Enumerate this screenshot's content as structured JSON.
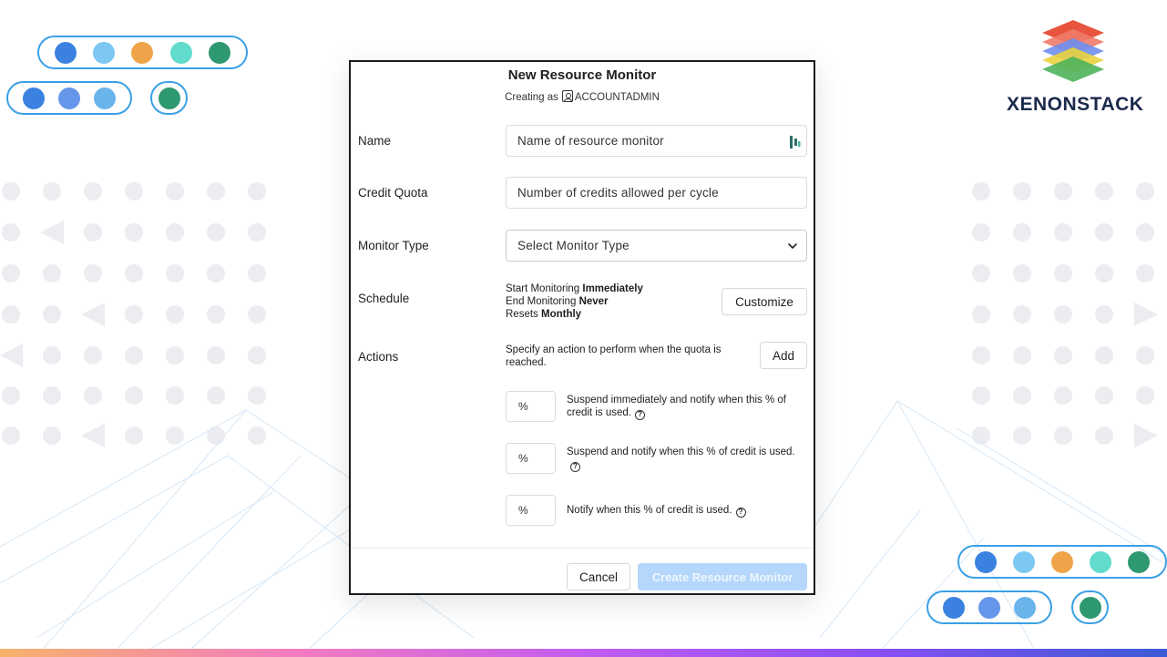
{
  "modal": {
    "title": "New Resource Monitor",
    "creating_as_prefix": "Creating as",
    "role": "ACCOUNTADMIN"
  },
  "form": {
    "name_label": "Name",
    "name_placeholder": "Name of resource monitor",
    "credit_label": "Credit Quota",
    "credit_placeholder": "Number of credits allowed per cycle",
    "monitor_type_label": "Monitor Type",
    "monitor_type_value": "Select Monitor Type",
    "schedule_label": "Schedule",
    "schedule": {
      "start_prefix": "Start Monitoring",
      "start_value": "Immediately",
      "end_prefix": "End Monitoring",
      "end_value": "Never",
      "reset_prefix": "Resets",
      "reset_value": "Monthly"
    },
    "customize_label": "Customize",
    "actions_label": "Actions",
    "actions_desc": "Specify an action to perform when the quota is reached.",
    "add_label": "Add",
    "thresholds": [
      {
        "placeholder": "%",
        "text": "Suspend immediately and notify when this % of credit is used."
      },
      {
        "placeholder": "%",
        "text": "Suspend and notify when this % of credit is used."
      },
      {
        "placeholder": "%",
        "text": "Notify when this % of credit is used."
      }
    ]
  },
  "footer": {
    "cancel_label": "Cancel",
    "create_label": "Create Resource Monitor"
  },
  "brand": {
    "logo_text": "XENONSTACK"
  },
  "colors": {
    "primary_disabled": "#b5d7fb",
    "pill_border": "#3aa0e6",
    "bottom_gradient": [
      "#f6b26b",
      "#f47cc0",
      "#c25cf0",
      "#8a4ff5",
      "#3b5bd6"
    ]
  }
}
